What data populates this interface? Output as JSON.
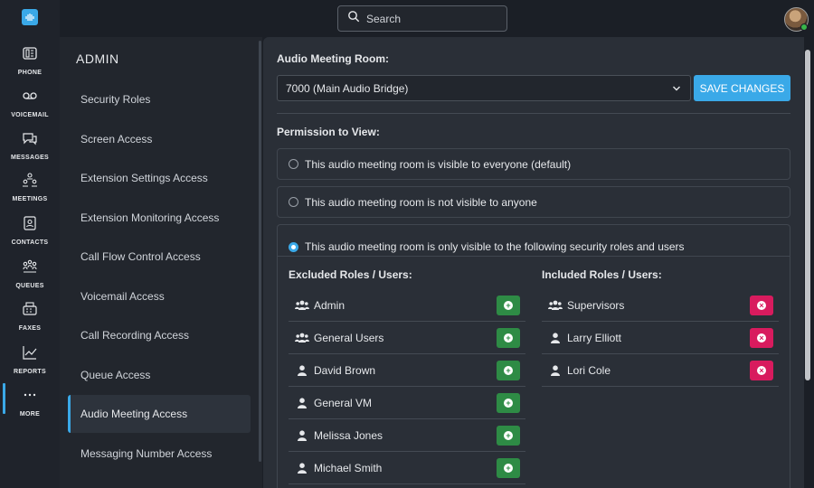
{
  "header": {
    "search_placeholder": "Search"
  },
  "rail": {
    "items": [
      {
        "label": "PHONE",
        "icon": "phone-icon"
      },
      {
        "label": "VOICEMAIL",
        "icon": "voicemail-icon"
      },
      {
        "label": "MESSAGES",
        "icon": "messages-icon"
      },
      {
        "label": "MEETINGS",
        "icon": "meetings-icon"
      },
      {
        "label": "CONTACTS",
        "icon": "contacts-icon"
      },
      {
        "label": "QUEUES",
        "icon": "queues-icon"
      },
      {
        "label": "FAXES",
        "icon": "faxes-icon"
      },
      {
        "label": "REPORTS",
        "icon": "reports-icon"
      },
      {
        "label": "MORE",
        "icon": "more-icon",
        "active": true
      }
    ]
  },
  "admin": {
    "title": "ADMIN",
    "items": [
      {
        "label": "Security Roles"
      },
      {
        "label": "Screen Access"
      },
      {
        "label": "Extension Settings Access"
      },
      {
        "label": "Extension Monitoring Access"
      },
      {
        "label": "Call Flow Control Access"
      },
      {
        "label": "Voicemail Access"
      },
      {
        "label": "Call Recording Access"
      },
      {
        "label": "Queue Access"
      },
      {
        "label": "Audio Meeting Access",
        "active": true
      },
      {
        "label": "Messaging Number Access"
      }
    ]
  },
  "main": {
    "room_label": "Audio Meeting Room:",
    "room_value": "7000 (Main Audio Bridge)",
    "save_label": "SAVE CHANGES",
    "permission_label": "Permission to View:",
    "options": [
      {
        "label": "This audio meeting room is visible to everyone (default)",
        "selected": false
      },
      {
        "label": "This audio meeting room is not visible to anyone",
        "selected": false
      },
      {
        "label": "This audio meeting room is only visible to the following security roles and users",
        "selected": true
      }
    ],
    "excluded_title": "Excluded Roles / Users:",
    "included_title": "Included Roles / Users:",
    "excluded": [
      {
        "name": "Admin",
        "type": "group"
      },
      {
        "name": "General Users",
        "type": "group"
      },
      {
        "name": "David Brown",
        "type": "user"
      },
      {
        "name": "General VM",
        "type": "user"
      },
      {
        "name": "Melissa Jones",
        "type": "user"
      },
      {
        "name": "Michael Smith",
        "type": "user"
      }
    ],
    "included": [
      {
        "name": "Supervisors",
        "type": "group"
      },
      {
        "name": "Larry Elliott",
        "type": "user"
      },
      {
        "name": "Lori Cole",
        "type": "user"
      }
    ]
  },
  "colors": {
    "accent": "#3aa9e8",
    "add": "#2e8b45",
    "remove": "#d81b5e"
  }
}
